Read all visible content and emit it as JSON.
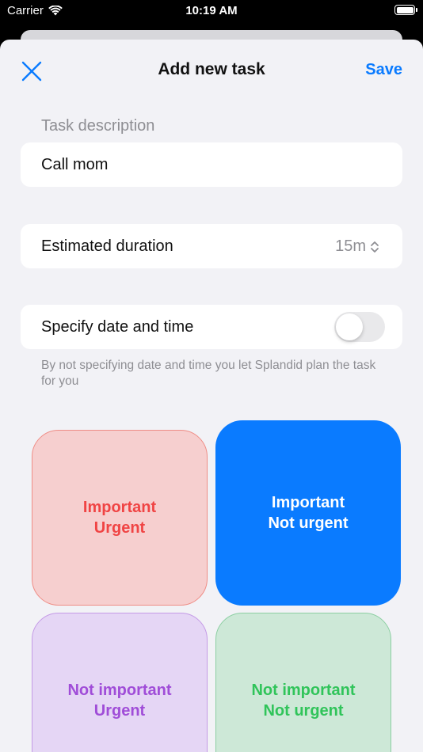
{
  "status_bar": {
    "carrier": "Carrier",
    "time": "10:19 AM"
  },
  "nav": {
    "title": "Add new task",
    "save_label": "Save"
  },
  "task": {
    "section_label": "Task description",
    "value": "Call mom"
  },
  "duration": {
    "label": "Estimated duration",
    "value": "15m"
  },
  "schedule": {
    "label": "Specify date and time",
    "enabled": false,
    "hint": "By not specifying date and time you let Splandid plan the task for you"
  },
  "quadrants": {
    "important_urgent": "Important\nUrgent",
    "important_not_urgent": "Important\nNot urgent",
    "not_important_urgent": "Not important\nUrgent",
    "not_important_not_urgent": "Not important\nNot urgent"
  },
  "colors": {
    "accent": "#0a7bff",
    "urgent_important": "#f04444",
    "not_important_urgent": "#a04dd8",
    "not_important_not_urgent": "#30c45a"
  }
}
